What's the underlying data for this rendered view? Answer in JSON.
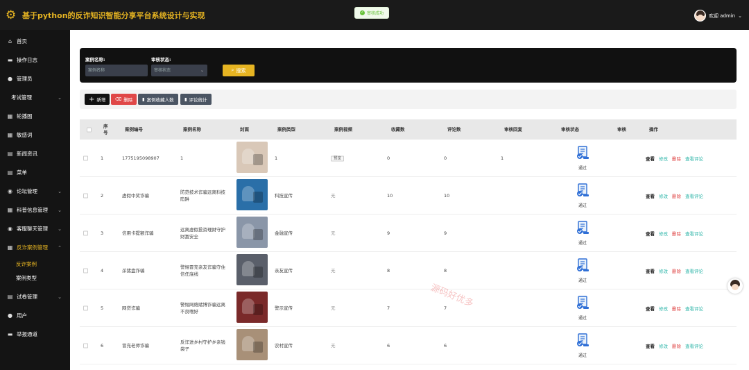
{
  "header": {
    "title": "基于python的反诈知识智能分享平台系统设计与实现",
    "toast": "审核成功",
    "welcome": "欢迎 admin"
  },
  "sidebar": {
    "items": [
      {
        "label": "首页",
        "icon": "home-icon",
        "glyph": "⌂"
      },
      {
        "label": "操作日志",
        "icon": "folder-icon",
        "glyph": "▬"
      },
      {
        "label": "管理员",
        "icon": "user-icon",
        "glyph": "●"
      },
      {
        "label": "考试管理",
        "icon": "",
        "glyph": "",
        "chevron": "⌄"
      },
      {
        "label": "轮播图",
        "icon": "grid-icon",
        "glyph": "▦"
      },
      {
        "label": "敏感词",
        "icon": "grid-icon",
        "glyph": "▦"
      },
      {
        "label": "新闻资讯",
        "icon": "news-icon",
        "glyph": "▤"
      },
      {
        "label": "菜单",
        "icon": "menu-icon",
        "glyph": "▤"
      },
      {
        "label": "论坛管理",
        "icon": "chat-icon",
        "glyph": "◉",
        "chevron": "⌄"
      },
      {
        "label": "科普信息管理",
        "icon": "book-icon",
        "glyph": "▦",
        "chevron": "⌄"
      },
      {
        "label": "客服聊天管理",
        "icon": "service-icon",
        "glyph": "◉",
        "chevron": "⌄"
      },
      {
        "label": "反诈案例管理",
        "icon": "case-icon",
        "glyph": "▦",
        "chevron": "⌃",
        "active": true
      }
    ],
    "sub_items": [
      {
        "label": "反诈案例",
        "active": true
      },
      {
        "label": "案例类型"
      }
    ],
    "items_after": [
      {
        "label": "试卷管理",
        "icon": "paper-icon",
        "glyph": "▤",
        "chevron": "⌄"
      },
      {
        "label": "用户",
        "icon": "user-icon",
        "glyph": "●"
      },
      {
        "label": "举报通道",
        "icon": "report-icon",
        "glyph": "▬"
      }
    ]
  },
  "search": {
    "name_label": "案例名称:",
    "name_placeholder": "案例名称",
    "status_label": "审核状态:",
    "status_placeholder": "审核状态",
    "search_button": "搜索"
  },
  "toolbar": {
    "add": "新增",
    "delete": "删除",
    "stat_collect": "案例收藏人数",
    "stat_comment": "评论统计"
  },
  "table": {
    "headers": {
      "index": "序\n号",
      "code": "案例编号",
      "name": "案例名称",
      "cover": "封面",
      "type": "案例类型",
      "video": "案例视频",
      "collect": "收藏数",
      "comment": "评论数",
      "reply": "审核回复",
      "status": "审核状态",
      "audit": "审核",
      "actions": "操作"
    },
    "rows": [
      {
        "index": "1",
        "code": "1775195098907",
        "name": "1",
        "type": "1",
        "video": "预览",
        "collect": "0",
        "comment": "0",
        "reply": "1",
        "status": "通过",
        "cover_color": "#d9c8b8"
      },
      {
        "index": "2",
        "code": "虚假中奖诈骗",
        "name": "防范技术诈骗远离科技陷阱",
        "type": "科技宣传",
        "video": "无",
        "collect": "10",
        "comment": "10",
        "reply": "",
        "status": "通过",
        "cover_color": "#2a6fa8"
      },
      {
        "index": "3",
        "code": "信用卡提额诈骗",
        "name": "远离虚假投资理财守护财富安全",
        "type": "金融宣传",
        "video": "无",
        "collect": "9",
        "comment": "9",
        "reply": "",
        "status": "通过",
        "cover_color": "#8a96a8"
      },
      {
        "index": "4",
        "code": "杀猪盘诈骗",
        "name": "警惕冒充亲友诈骗守住信任底线",
        "type": "亲友宣传",
        "video": "无",
        "collect": "8",
        "comment": "8",
        "reply": "",
        "status": "通过",
        "cover_color": "#5a5f6a"
      },
      {
        "index": "5",
        "code": "网贷诈骗",
        "name": "警惕网络赌博诈骗远离不良嗜好",
        "type": "警示宣传",
        "video": "无",
        "collect": "7",
        "comment": "7",
        "reply": "",
        "status": "通过",
        "cover_color": "#7a2a2a"
      },
      {
        "index": "6",
        "code": "冒充老师诈骗",
        "name": "反诈进乡村守护乡亲钱袋子",
        "type": "农村宣传",
        "video": "无",
        "collect": "6",
        "comment": "6",
        "reply": "",
        "status": "通过",
        "cover_color": "#a89078"
      }
    ],
    "actions": {
      "view": "查看",
      "edit": "修改",
      "delete": "删除",
      "comments": "查看评论"
    }
  },
  "watermark": "源码好优多"
}
